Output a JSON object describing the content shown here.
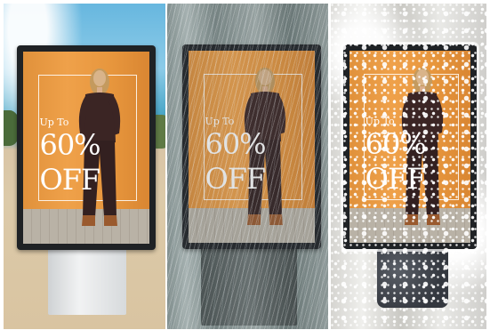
{
  "ad": {
    "up_to": "Up To",
    "discount": "60%",
    "off": "OFF"
  }
}
